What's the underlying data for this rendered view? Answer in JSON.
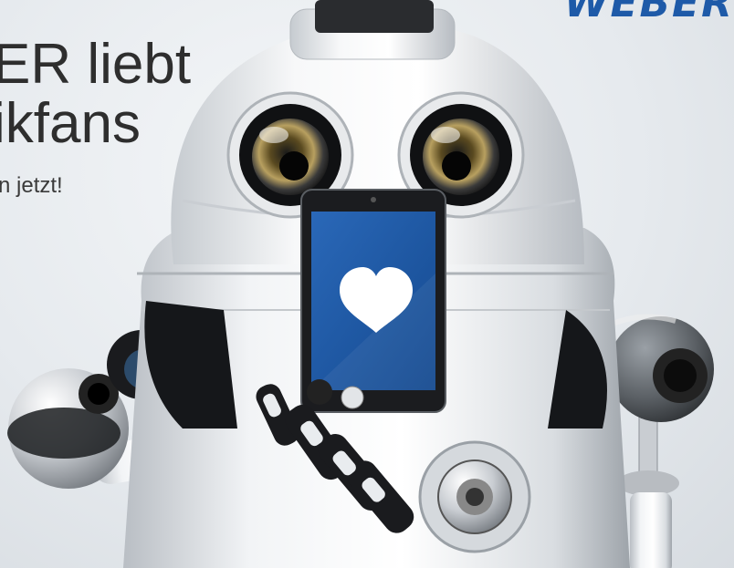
{
  "brand": {
    "text": "WEBER",
    "color": "#1e5aa8"
  },
  "headline": {
    "line1": "ER liebt",
    "line2": "ikfans"
  },
  "subline": "n jetzt!",
  "phone": {
    "screen_color": "#1d56a6",
    "icon": "heart-icon"
  }
}
